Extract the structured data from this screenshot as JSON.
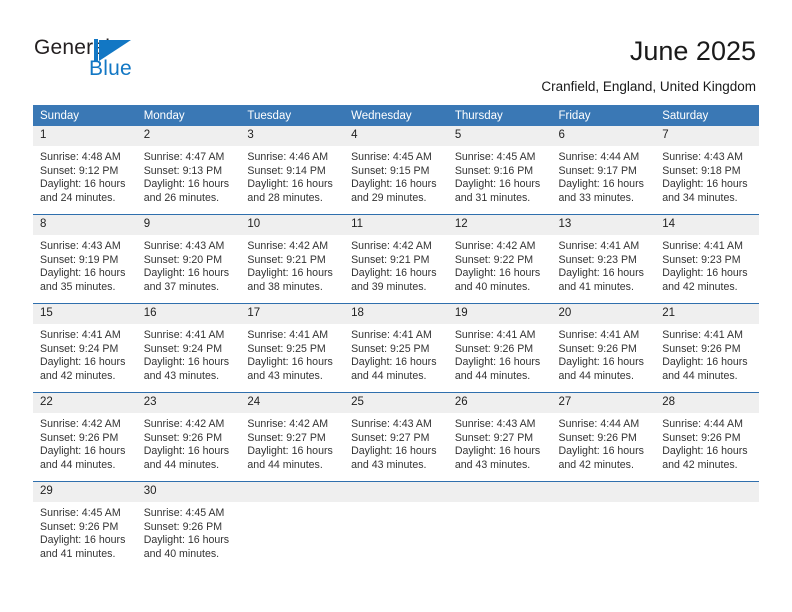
{
  "brand": {
    "name_primary": "General",
    "name_secondary": "Blue",
    "logo_icon": "triangle-flag-icon",
    "primary_color": "#1277c4",
    "text_color": "#231f20"
  },
  "header": {
    "title": "June 2025",
    "subtitle": "Cranfield, England, United Kingdom"
  },
  "theme": {
    "header_bg": "#3a78b5",
    "header_text": "#ffffff",
    "daynum_bg": "#efefef",
    "week_divider": "#2f6fad"
  },
  "calendar": {
    "weekday_headers": [
      "Sunday",
      "Monday",
      "Tuesday",
      "Wednesday",
      "Thursday",
      "Friday",
      "Saturday"
    ],
    "weeks": [
      [
        {
          "day": "1",
          "sunrise": "Sunrise: 4:48 AM",
          "sunset": "Sunset: 9:12 PM",
          "daylight_line1": "Daylight: 16 hours",
          "daylight_line2": "and 24 minutes."
        },
        {
          "day": "2",
          "sunrise": "Sunrise: 4:47 AM",
          "sunset": "Sunset: 9:13 PM",
          "daylight_line1": "Daylight: 16 hours",
          "daylight_line2": "and 26 minutes."
        },
        {
          "day": "3",
          "sunrise": "Sunrise: 4:46 AM",
          "sunset": "Sunset: 9:14 PM",
          "daylight_line1": "Daylight: 16 hours",
          "daylight_line2": "and 28 minutes."
        },
        {
          "day": "4",
          "sunrise": "Sunrise: 4:45 AM",
          "sunset": "Sunset: 9:15 PM",
          "daylight_line1": "Daylight: 16 hours",
          "daylight_line2": "and 29 minutes."
        },
        {
          "day": "5",
          "sunrise": "Sunrise: 4:45 AM",
          "sunset": "Sunset: 9:16 PM",
          "daylight_line1": "Daylight: 16 hours",
          "daylight_line2": "and 31 minutes."
        },
        {
          "day": "6",
          "sunrise": "Sunrise: 4:44 AM",
          "sunset": "Sunset: 9:17 PM",
          "daylight_line1": "Daylight: 16 hours",
          "daylight_line2": "and 33 minutes."
        },
        {
          "day": "7",
          "sunrise": "Sunrise: 4:43 AM",
          "sunset": "Sunset: 9:18 PM",
          "daylight_line1": "Daylight: 16 hours",
          "daylight_line2": "and 34 minutes."
        }
      ],
      [
        {
          "day": "8",
          "sunrise": "Sunrise: 4:43 AM",
          "sunset": "Sunset: 9:19 PM",
          "daylight_line1": "Daylight: 16 hours",
          "daylight_line2": "and 35 minutes."
        },
        {
          "day": "9",
          "sunrise": "Sunrise: 4:43 AM",
          "sunset": "Sunset: 9:20 PM",
          "daylight_line1": "Daylight: 16 hours",
          "daylight_line2": "and 37 minutes."
        },
        {
          "day": "10",
          "sunrise": "Sunrise: 4:42 AM",
          "sunset": "Sunset: 9:21 PM",
          "daylight_line1": "Daylight: 16 hours",
          "daylight_line2": "and 38 minutes."
        },
        {
          "day": "11",
          "sunrise": "Sunrise: 4:42 AM",
          "sunset": "Sunset: 9:21 PM",
          "daylight_line1": "Daylight: 16 hours",
          "daylight_line2": "and 39 minutes."
        },
        {
          "day": "12",
          "sunrise": "Sunrise: 4:42 AM",
          "sunset": "Sunset: 9:22 PM",
          "daylight_line1": "Daylight: 16 hours",
          "daylight_line2": "and 40 minutes."
        },
        {
          "day": "13",
          "sunrise": "Sunrise: 4:41 AM",
          "sunset": "Sunset: 9:23 PM",
          "daylight_line1": "Daylight: 16 hours",
          "daylight_line2": "and 41 minutes."
        },
        {
          "day": "14",
          "sunrise": "Sunrise: 4:41 AM",
          "sunset": "Sunset: 9:23 PM",
          "daylight_line1": "Daylight: 16 hours",
          "daylight_line2": "and 42 minutes."
        }
      ],
      [
        {
          "day": "15",
          "sunrise": "Sunrise: 4:41 AM",
          "sunset": "Sunset: 9:24 PM",
          "daylight_line1": "Daylight: 16 hours",
          "daylight_line2": "and 42 minutes."
        },
        {
          "day": "16",
          "sunrise": "Sunrise: 4:41 AM",
          "sunset": "Sunset: 9:24 PM",
          "daylight_line1": "Daylight: 16 hours",
          "daylight_line2": "and 43 minutes."
        },
        {
          "day": "17",
          "sunrise": "Sunrise: 4:41 AM",
          "sunset": "Sunset: 9:25 PM",
          "daylight_line1": "Daylight: 16 hours",
          "daylight_line2": "and 43 minutes."
        },
        {
          "day": "18",
          "sunrise": "Sunrise: 4:41 AM",
          "sunset": "Sunset: 9:25 PM",
          "daylight_line1": "Daylight: 16 hours",
          "daylight_line2": "and 44 minutes."
        },
        {
          "day": "19",
          "sunrise": "Sunrise: 4:41 AM",
          "sunset": "Sunset: 9:26 PM",
          "daylight_line1": "Daylight: 16 hours",
          "daylight_line2": "and 44 minutes."
        },
        {
          "day": "20",
          "sunrise": "Sunrise: 4:41 AM",
          "sunset": "Sunset: 9:26 PM",
          "daylight_line1": "Daylight: 16 hours",
          "daylight_line2": "and 44 minutes."
        },
        {
          "day": "21",
          "sunrise": "Sunrise: 4:41 AM",
          "sunset": "Sunset: 9:26 PM",
          "daylight_line1": "Daylight: 16 hours",
          "daylight_line2": "and 44 minutes."
        }
      ],
      [
        {
          "day": "22",
          "sunrise": "Sunrise: 4:42 AM",
          "sunset": "Sunset: 9:26 PM",
          "daylight_line1": "Daylight: 16 hours",
          "daylight_line2": "and 44 minutes."
        },
        {
          "day": "23",
          "sunrise": "Sunrise: 4:42 AM",
          "sunset": "Sunset: 9:26 PM",
          "daylight_line1": "Daylight: 16 hours",
          "daylight_line2": "and 44 minutes."
        },
        {
          "day": "24",
          "sunrise": "Sunrise: 4:42 AM",
          "sunset": "Sunset: 9:27 PM",
          "daylight_line1": "Daylight: 16 hours",
          "daylight_line2": "and 44 minutes."
        },
        {
          "day": "25",
          "sunrise": "Sunrise: 4:43 AM",
          "sunset": "Sunset: 9:27 PM",
          "daylight_line1": "Daylight: 16 hours",
          "daylight_line2": "and 43 minutes."
        },
        {
          "day": "26",
          "sunrise": "Sunrise: 4:43 AM",
          "sunset": "Sunset: 9:27 PM",
          "daylight_line1": "Daylight: 16 hours",
          "daylight_line2": "and 43 minutes."
        },
        {
          "day": "27",
          "sunrise": "Sunrise: 4:44 AM",
          "sunset": "Sunset: 9:26 PM",
          "daylight_line1": "Daylight: 16 hours",
          "daylight_line2": "and 42 minutes."
        },
        {
          "day": "28",
          "sunrise": "Sunrise: 4:44 AM",
          "sunset": "Sunset: 9:26 PM",
          "daylight_line1": "Daylight: 16 hours",
          "daylight_line2": "and 42 minutes."
        }
      ],
      [
        {
          "day": "29",
          "sunrise": "Sunrise: 4:45 AM",
          "sunset": "Sunset: 9:26 PM",
          "daylight_line1": "Daylight: 16 hours",
          "daylight_line2": "and 41 minutes."
        },
        {
          "day": "30",
          "sunrise": "Sunrise: 4:45 AM",
          "sunset": "Sunset: 9:26 PM",
          "daylight_line1": "Daylight: 16 hours",
          "daylight_line2": "and 40 minutes."
        },
        {
          "day": "",
          "sunrise": "",
          "sunset": "",
          "daylight_line1": "",
          "daylight_line2": ""
        },
        {
          "day": "",
          "sunrise": "",
          "sunset": "",
          "daylight_line1": "",
          "daylight_line2": ""
        },
        {
          "day": "",
          "sunrise": "",
          "sunset": "",
          "daylight_line1": "",
          "daylight_line2": ""
        },
        {
          "day": "",
          "sunrise": "",
          "sunset": "",
          "daylight_line1": "",
          "daylight_line2": ""
        },
        {
          "day": "",
          "sunrise": "",
          "sunset": "",
          "daylight_line1": "",
          "daylight_line2": ""
        }
      ]
    ]
  }
}
